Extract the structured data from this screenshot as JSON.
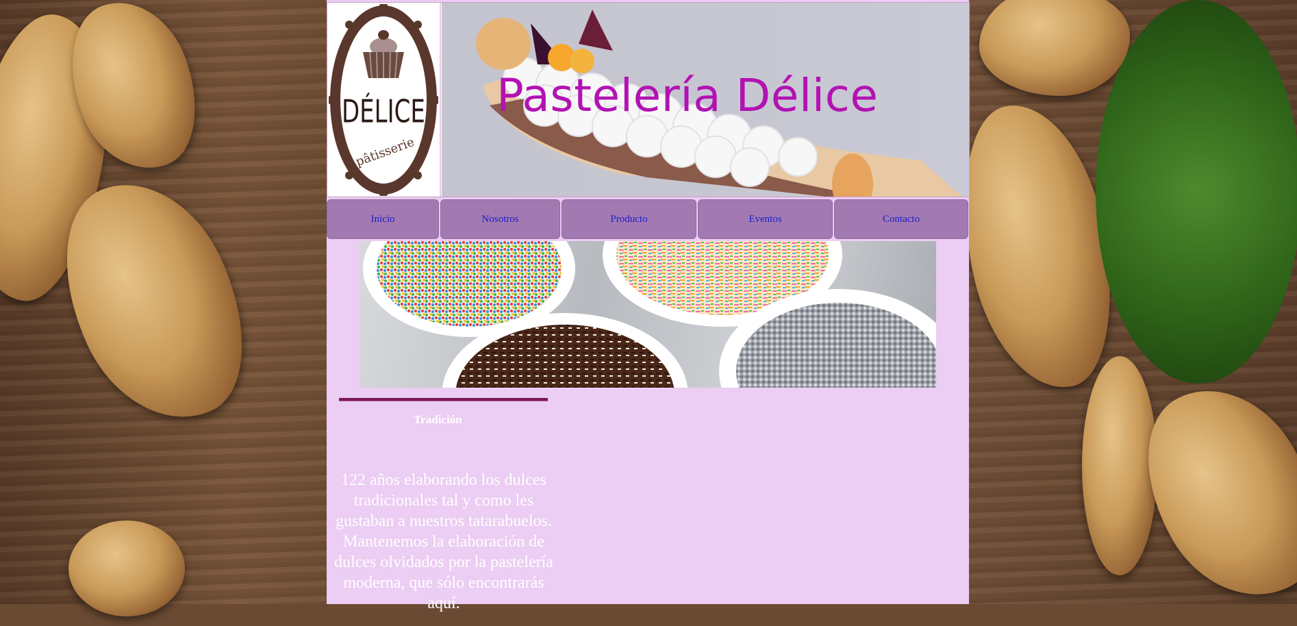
{
  "site": {
    "title": "Pastelería Délice",
    "logo_text": "DÉLICE",
    "logo_subtext": "pâtisserie"
  },
  "nav": {
    "items": [
      {
        "label": "Inicio"
      },
      {
        "label": "Nosotros"
      },
      {
        "label": "Producto"
      },
      {
        "label": "Eventos"
      },
      {
        "label": "Contacto"
      }
    ]
  },
  "section": {
    "title": "Tradición",
    "text": "122 años elaborando los dulces tradicionales tal y como les gustaban a nuestros tatarabuelos. Mantenemos la elaboración de dulces olvidados por la pastelería moderna, que sólo encontrarás aquí."
  },
  "colors": {
    "page_bg": "#eccdf3",
    "nav_bg": "#a27ab1",
    "nav_text": "#1b1bd0",
    "title": "#b312b3",
    "divider": "#7b1a52"
  }
}
